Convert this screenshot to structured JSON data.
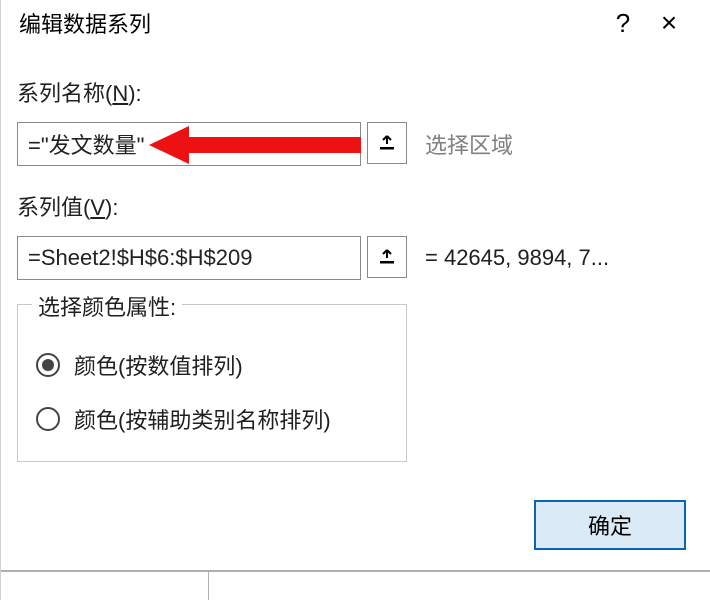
{
  "titlebar": {
    "title": "编辑数据系列",
    "help_symbol": "?",
    "close_symbol": "×"
  },
  "series_name": {
    "label_prefix": "系列名称(",
    "mnemonic": "N",
    "label_suffix": "):",
    "value": "=\"发文数量\"",
    "side_text": "选择区域"
  },
  "series_values": {
    "label_prefix": "系列值(",
    "mnemonic": "V",
    "label_suffix": "):",
    "value": "=Sheet2!$H$6:$H$209",
    "side_text": "= 42645, 9894, 7..."
  },
  "groupbox": {
    "legend": "选择颜色属性:",
    "option_by_value": "颜色(按数值排列)",
    "option_by_category": "颜色(按辅助类别名称排列)"
  },
  "buttons": {
    "ok": "确定"
  }
}
